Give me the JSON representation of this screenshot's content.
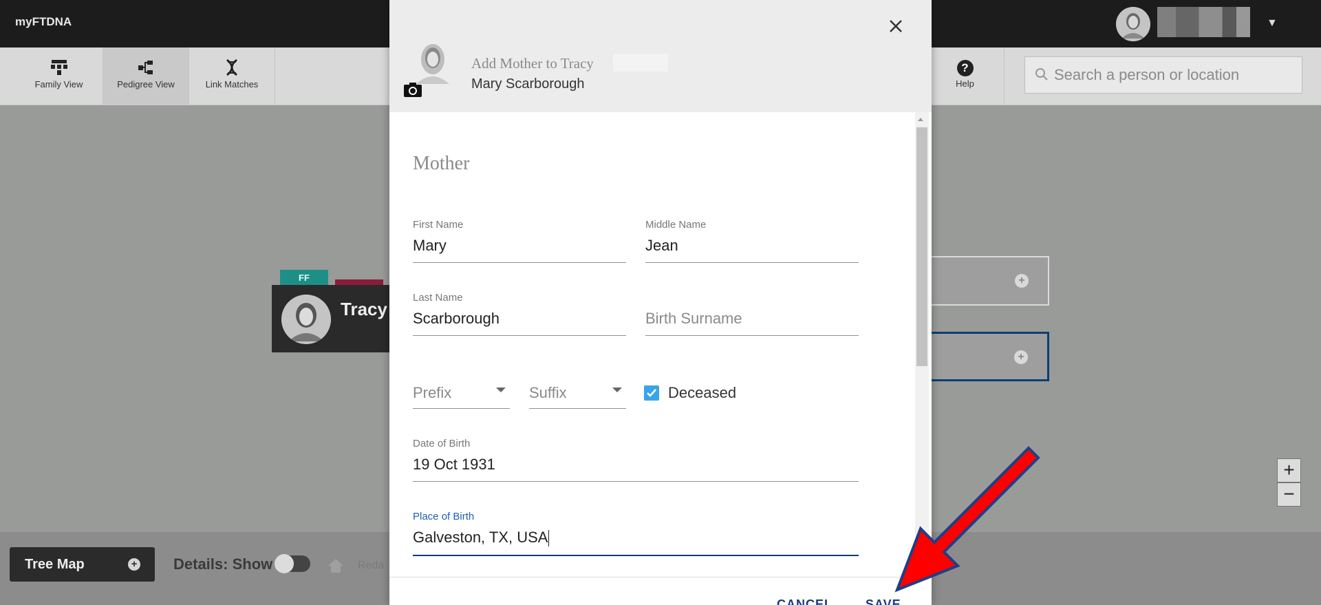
{
  "app": {
    "brand": "myFTDNA"
  },
  "toolbar": {
    "family_view": "Family View",
    "pedigree_view": "Pedigree View",
    "link_matches": "Link Matches",
    "help": "Help",
    "search_placeholder": "Search a person or location"
  },
  "tree": {
    "tag_ff": "FF",
    "person_name": "Tracy"
  },
  "bottombar": {
    "tree_map": "Tree Map",
    "details": "Details: Show",
    "home_text": "Reda"
  },
  "dialog": {
    "title": "Add Mother to Tracy",
    "subtitle": "Mary Scarborough",
    "section": "Mother",
    "first_name": {
      "label": "First Name",
      "value": "Mary"
    },
    "middle_name": {
      "label": "Middle Name",
      "value": "Jean"
    },
    "last_name": {
      "label": "Last Name",
      "value": "Scarborough"
    },
    "birth_surname": {
      "placeholder": "Birth Surname"
    },
    "prefix": {
      "placeholder": "Prefix"
    },
    "suffix": {
      "placeholder": "Suffix"
    },
    "deceased": {
      "label": "Deceased",
      "checked": true
    },
    "date_of_birth": {
      "label": "Date of Birth",
      "value": "19 Oct 1931"
    },
    "place_of_birth": {
      "label": "Place of Birth",
      "value": "Galveston, TX, USA"
    },
    "cancel": "CANCEL",
    "save": "SAVE"
  },
  "colors": {
    "annotation_arrow": "#ff0000",
    "accent": "#0e3a75",
    "checkbox": "#3aa4e8"
  }
}
